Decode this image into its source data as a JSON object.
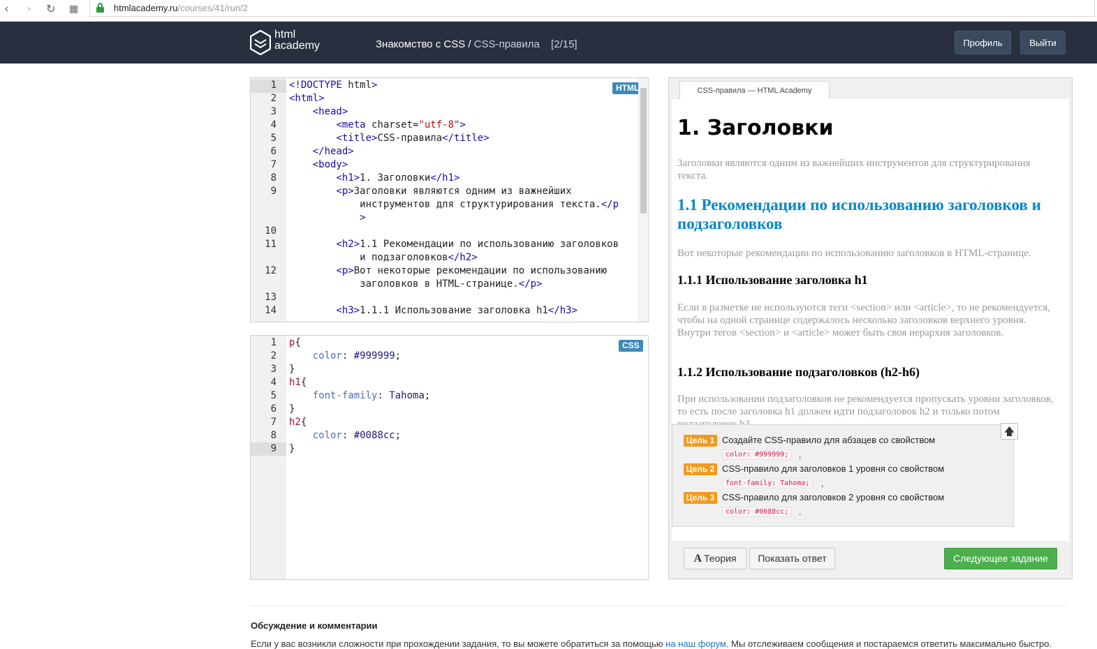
{
  "browser": {
    "url_host": "htmlacademy.ru",
    "url_path": "/courses/41/run/2"
  },
  "header": {
    "logo_line1": "html",
    "logo_line2": "academy",
    "course": "Знакомство с CSS /",
    "lesson": "CSS-правила",
    "progress": "[2/15]",
    "profile_button": "Профиль",
    "logout_button": "Выйти",
    "bg_color": "#283040"
  },
  "html_editor": {
    "lang_label": "HTML",
    "line_numbers": [
      "1",
      "2",
      "3",
      "4",
      "5",
      "6",
      "7",
      "8",
      "9",
      "10",
      "11",
      "12",
      "13",
      "14"
    ],
    "lines": [
      "<!DOCTYPE html>",
      "<html>",
      "    <head>",
      "        <meta charset=\"utf-8\">",
      "        <title>CSS-правила</title>",
      "    </head>",
      "    <body>",
      "        <h1>1. Заголовки</h1>",
      "        <p>Заголовки являются одним из важнейших",
      "            инструментов для структурирования текста.</p",
      "            >",
      "",
      "        <h2>1.1 Рекомендации по использованию заголовков",
      "            и подзаголовков</h2>",
      "        <p>Вот некоторые рекомендации по использованию",
      "            заголовков в HTML-странице.</p>",
      "",
      "        <h3>1.1.1 Использование заголовка h1</h3>"
    ]
  },
  "css_editor": {
    "lang_label": "CSS",
    "line_numbers": [
      "1",
      "2",
      "3",
      "4",
      "5",
      "6",
      "7",
      "8",
      "9"
    ],
    "lines": [
      "p{",
      "    color: #999999;",
      "}",
      "h1{",
      "    font-family: Tahoma;",
      "}",
      "h2{",
      "    color: #0088cc;",
      "}"
    ]
  },
  "preview": {
    "tab_title": "CSS-правила — HTML Academy",
    "h1": "1. Заголовки",
    "p1": "Заголовки являются одним из важнейших инструментов для структурирования текста.",
    "h2": "1.1 Рекомендации по использованию заголовков и подзаголовков",
    "p2": "Вот некоторые рекомендации по использованию заголовков в HTML-странице.",
    "h3a": "1.1.1 Использование заголовка h1",
    "p3": "Если в разметке не используются теги <section> или <article>, то не рекомендуется, чтобы на одной странице содержалось несколько заголовков верхнего уровня. Внутри тегов <section> и <article> может быть своя иерархия заголовков.",
    "h3b": "1.1.2 Использование подзаголовков (h2-h6)",
    "p4": "При использовании подзаголовков не рекомендуется пропускать уровни заголовков, то есть после заголовка h1 должен идти подзаголовок h2 и только потом подзаголовок h3.",
    "p_color": "#999999",
    "h2_color": "#0088cc"
  },
  "goals": [
    {
      "badge": "Цель 1",
      "text": "Создайте CSS-правило для абзацев со свойством",
      "code": "color: #999999;",
      "tail": ","
    },
    {
      "badge": "Цель 2",
      "text": "CSS-правило для заголовков 1 уровня со свойством",
      "code": "font-family: Tahoma;",
      "tail": ","
    },
    {
      "badge": "Цель 3",
      "text": "CSS-правило для заголовков 2 уровня со свойством",
      "code": "color: #0088cc;",
      "tail": "."
    }
  ],
  "goals_toggle_icon": "arrow-up-icon",
  "buttons": {
    "theory": "Теория",
    "theory_icon": "A",
    "show_answer": "Показать ответ",
    "next_task": "Следующее задание",
    "next_color": "#4cae4c"
  },
  "discussion": {
    "title": "Обсуждение и комментарии",
    "text_before": "Если у вас возникли сложности при прохождении задания, то вы можете обратиться за помощью ",
    "link": "на наш форум",
    "text_after": ". Мы отслеживаем сообщения и постараемся ответить максимально быстро."
  }
}
